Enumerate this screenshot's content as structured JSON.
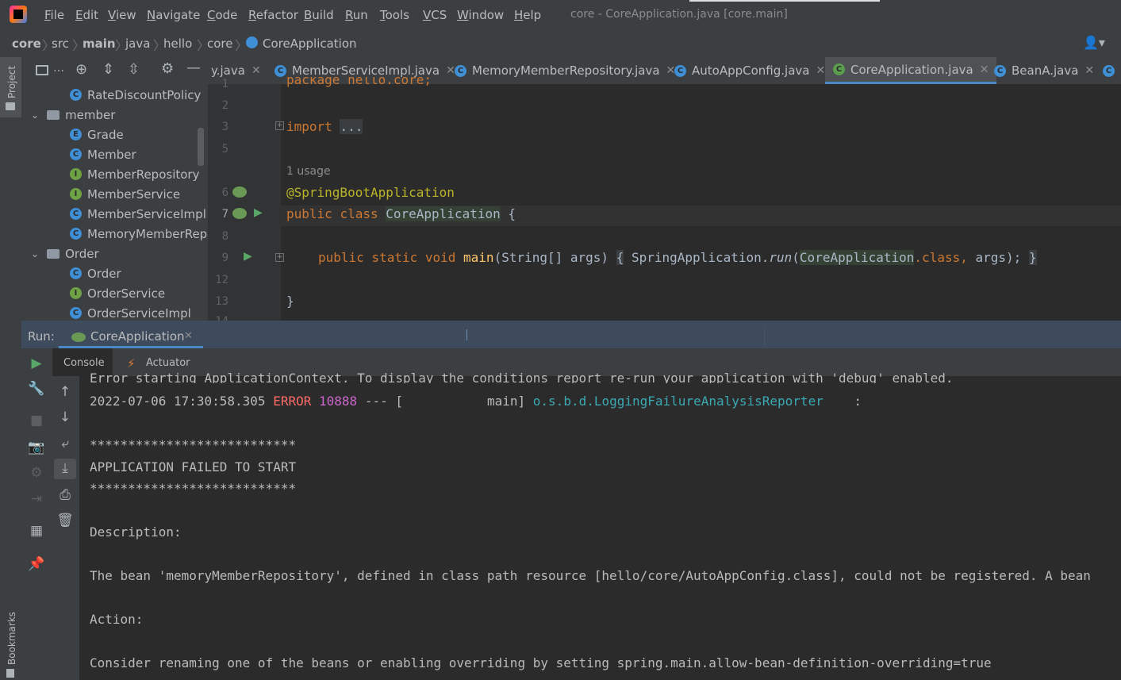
{
  "menu": {
    "items": [
      "File",
      "Edit",
      "View",
      "Navigate",
      "Code",
      "Refactor",
      "Build",
      "Run",
      "Tools",
      "VCS",
      "Window",
      "Help"
    ],
    "window_title": "core - CoreApplication.java [core.main]"
  },
  "breadcrumb": {
    "items": [
      "core",
      "src",
      "main",
      "java",
      "hello",
      "core"
    ],
    "current": "CoreApplication"
  },
  "left_stripe": {
    "project_label": "Project",
    "bookmarks_label": "Bookmarks"
  },
  "project_tree": {
    "rows": [
      {
        "type": "class",
        "label": "RateDiscountPolicy"
      },
      {
        "type": "folder",
        "label": "member"
      },
      {
        "type": "enum",
        "label": "Grade"
      },
      {
        "type": "class",
        "label": "Member"
      },
      {
        "type": "interface",
        "label": "MemberRepository"
      },
      {
        "type": "interface",
        "label": "MemberService"
      },
      {
        "type": "class",
        "label": "MemberServiceImpl"
      },
      {
        "type": "class",
        "label": "MemoryMemberRepos"
      },
      {
        "type": "folder",
        "label": "Order"
      },
      {
        "type": "class",
        "label": "Order"
      },
      {
        "type": "interface",
        "label": "OrderService"
      },
      {
        "type": "class",
        "label": "OrderServiceImpl"
      }
    ]
  },
  "tabs": [
    {
      "label": "y.java"
    },
    {
      "label": "MemberServiceImpl.java"
    },
    {
      "label": "MemoryMemberRepository.java"
    },
    {
      "label": "AutoAppConfig.java"
    },
    {
      "label": "CoreApplication.java",
      "active": true
    },
    {
      "label": "BeanA.java"
    }
  ],
  "editor": {
    "line_numbers": [
      "1",
      "2",
      "3",
      "5",
      "6",
      "7",
      "8",
      "9",
      "12",
      "13",
      "14"
    ],
    "usage_hint": "1 usage",
    "lines": {
      "package": "package hello.core;",
      "import_kw": "import",
      "import_fold": "...",
      "annotation": "@SpringBootApplication",
      "class_public": "public",
      "class_kw": "class",
      "class_name": "CoreApplication",
      "class_brace": "{",
      "main_mods": "public static void",
      "main_name": "main",
      "main_params": "(String[] args)",
      "main_body_open": "{",
      "main_call_prefix": "SpringApplication.",
      "main_call_run": "run",
      "main_call_paren": "(",
      "main_call_arg": "CoreApplication",
      "main_call_dot_class": ".class,",
      "main_call_args": " args);",
      "main_body_close": "}",
      "close_brace": "}"
    }
  },
  "run": {
    "label": "Run:",
    "config": "CoreApplication",
    "subtabs": [
      "Console",
      "Actuator"
    ]
  },
  "console": {
    "line0": "Error starting ApplicationContext. To display the conditions report re-run your application with 'debug' enabled.",
    "line1_ts": "2022-07-06 17:30:58.305",
    "line1_level": "ERROR",
    "line1_pid": "10888",
    "line1_sep": "---",
    "line1_thread": "[           main]",
    "line1_logger": "o.s.b.d.LoggingFailureAnalysisReporter",
    "line1_colon": ":",
    "stars": "***************************",
    "failed": "APPLICATION FAILED TO START",
    "description_label": "Description:",
    "description": "The bean 'memoryMemberRepository', defined in class path resource [hello/core/AutoAppConfig.class], could not be registered. A bean",
    "action_label": "Action:",
    "action": "Consider renaming one of the beans or enabling overriding by setting spring.main.allow-bean-definition-overriding=true"
  },
  "colors": {
    "bg_editor": "#2b2b2b",
    "bg_panel": "#3c3f41",
    "run_header": "#3d4b5c",
    "keyword": "#cc7832",
    "annotation": "#bbb529",
    "error": "#ff6b68",
    "logger": "#3ba9b3"
  }
}
